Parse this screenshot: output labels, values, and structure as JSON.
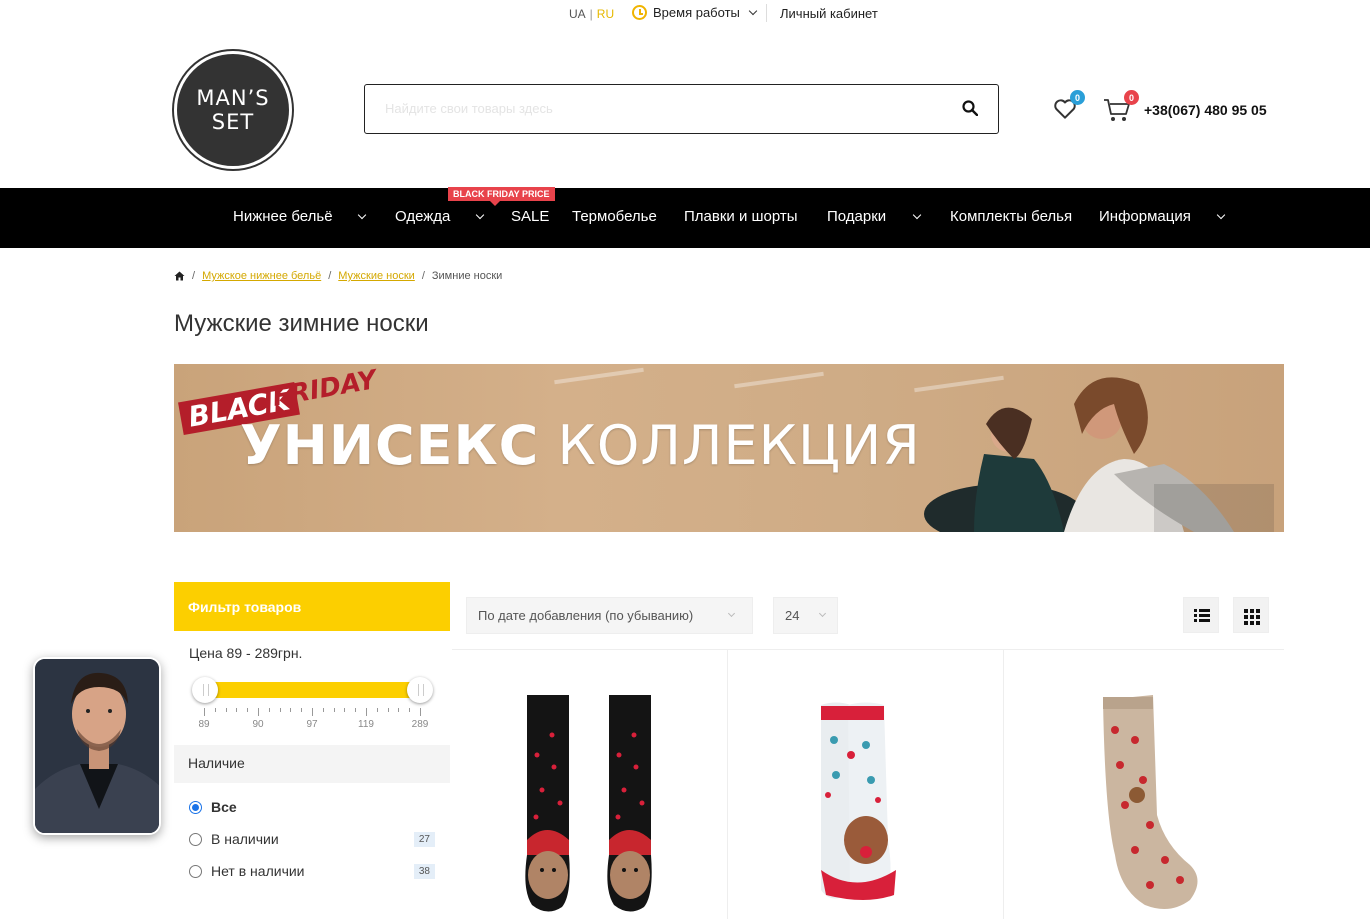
{
  "topbar": {
    "lang_ua": "UA",
    "lang_ru": "RU",
    "hours_label": "Время работы",
    "cabinet_label": "Личный кабинет"
  },
  "header": {
    "logo_line1": "MAN’S",
    "logo_line2": "SET",
    "search_placeholder": "Найдите свои товары здесь",
    "wishlist_count": "0",
    "cart_count": "0",
    "phone": "+38(067) 480 95 05"
  },
  "nav": {
    "items": [
      {
        "label": "Нижнее бельё"
      },
      {
        "label": "Одежда"
      },
      {
        "label": "SALE"
      },
      {
        "label": "Термобелье"
      },
      {
        "label": "Плавки и шорты"
      },
      {
        "label": "Подарки"
      },
      {
        "label": "Комплекты белья"
      },
      {
        "label": "Информация"
      }
    ],
    "sale_tag": "BLACK FRIDAY PRICE"
  },
  "breadcrumb": {
    "items": [
      "Мужское нижнее бельё",
      "Мужские носки",
      "Зимние носки"
    ]
  },
  "page_title": "Мужские зимние носки",
  "banner": {
    "black": "BLACK",
    "friday": "FRIDAY",
    "line_bold": "УНИСЕКС",
    "line_light": " КОЛЛЕКЦИЯ"
  },
  "filter": {
    "title": "Фильтр товаров",
    "price_label": "Цена  89 - 289грн.",
    "price_min": 89,
    "price_max": 289,
    "tick_labels": [
      "89",
      "90",
      "97",
      "119",
      "289"
    ],
    "availability_title": "Наличие",
    "options": [
      {
        "label": "Все",
        "selected": true,
        "count": ""
      },
      {
        "label": "В наличии",
        "selected": false,
        "count": "27"
      },
      {
        "label": "Нет в наличии",
        "selected": false,
        "count": "38"
      }
    ]
  },
  "toolbar": {
    "sort_value": "По дате добавления (по убыванию)",
    "per_page": "24"
  },
  "colors": {
    "accent": "#fccf00",
    "nav_bg": "#000000",
    "sale_red": "#e8434b",
    "badge_blue": "#2a9fd8"
  }
}
